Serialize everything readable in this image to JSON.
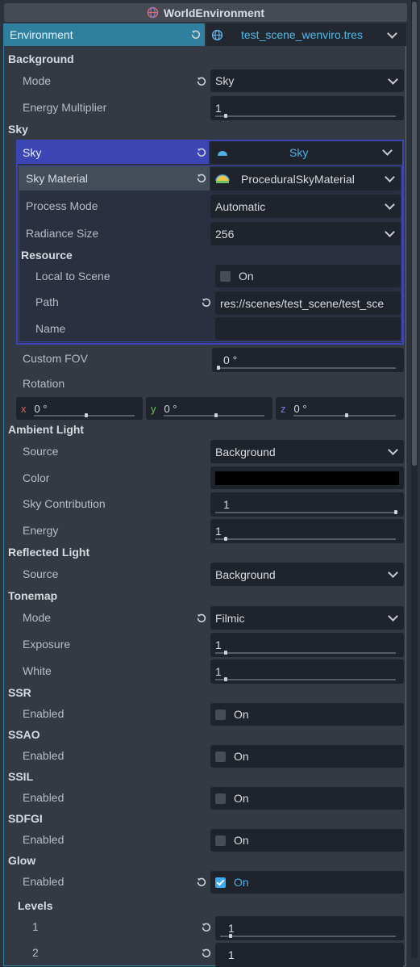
{
  "title": "WorldEnvironment",
  "resource": {
    "label": "Environment",
    "value": "test_scene_wenviro.tres"
  },
  "background": {
    "section": "Background",
    "mode_label": "Mode",
    "mode_value": "Sky",
    "energy_label": "Energy Multiplier",
    "energy_value": "1",
    "energy_fraction": 0.06
  },
  "sky": {
    "section": "Sky",
    "sky_label": "Sky",
    "sky_value": "Sky",
    "material_label": "Sky Material",
    "material_value": "ProceduralSkyMaterial",
    "process_label": "Process Mode",
    "process_value": "Automatic",
    "radiance_label": "Radiance Size",
    "radiance_value": "256",
    "resource_section": "Resource",
    "local_label": "Local to Scene",
    "local_value": "On",
    "path_label": "Path",
    "path_value": "res://scenes/test_scene/test_sce",
    "name_label": "Name",
    "name_value": "",
    "fov_label": "Custom FOV",
    "fov_value": "0 °",
    "rotation_label": "Rotation",
    "rot_x_axis": "x",
    "rot_x": "0 °",
    "rot_y_axis": "y",
    "rot_y": "0 °",
    "rot_z_axis": "z",
    "rot_z": "0 °"
  },
  "ambient": {
    "section": "Ambient Light",
    "source_label": "Source",
    "source_value": "Background",
    "color_label": "Color",
    "color_value": "#000000",
    "contrib_label": "Sky Contribution",
    "contrib_value": "1",
    "contrib_fraction": 1.0,
    "energy_label": "Energy",
    "energy_value": "1",
    "energy_fraction": 0.06
  },
  "reflected": {
    "section": "Reflected Light",
    "source_label": "Source",
    "source_value": "Background"
  },
  "tonemap": {
    "section": "Tonemap",
    "mode_label": "Mode",
    "mode_value": "Filmic",
    "exposure_label": "Exposure",
    "exposure_value": "1",
    "exposure_fraction": 0.06,
    "white_label": "White",
    "white_value": "1",
    "white_fraction": 0.06
  },
  "toggles": [
    {
      "section": "SSR",
      "label": "Enabled",
      "value": "On",
      "checked": false
    },
    {
      "section": "SSAO",
      "label": "Enabled",
      "value": "On",
      "checked": false
    },
    {
      "section": "SSIL",
      "label": "Enabled",
      "value": "On",
      "checked": false
    },
    {
      "section": "SDFGI",
      "label": "Enabled",
      "value": "On",
      "checked": false
    },
    {
      "section": "Glow",
      "label": "Enabled",
      "value": "On",
      "checked": true
    }
  ],
  "glow_levels": {
    "section": "Levels",
    "items": [
      {
        "label": "1",
        "value": "1",
        "fraction": 0.06
      },
      {
        "label": "2",
        "value": "1",
        "fraction": 0.06
      }
    ]
  },
  "colors": {
    "accent": "#2f7f9e",
    "sky_accent": "#3b45b3",
    "checkbox_on": "#3daaf3",
    "link": "#53b8e6"
  }
}
